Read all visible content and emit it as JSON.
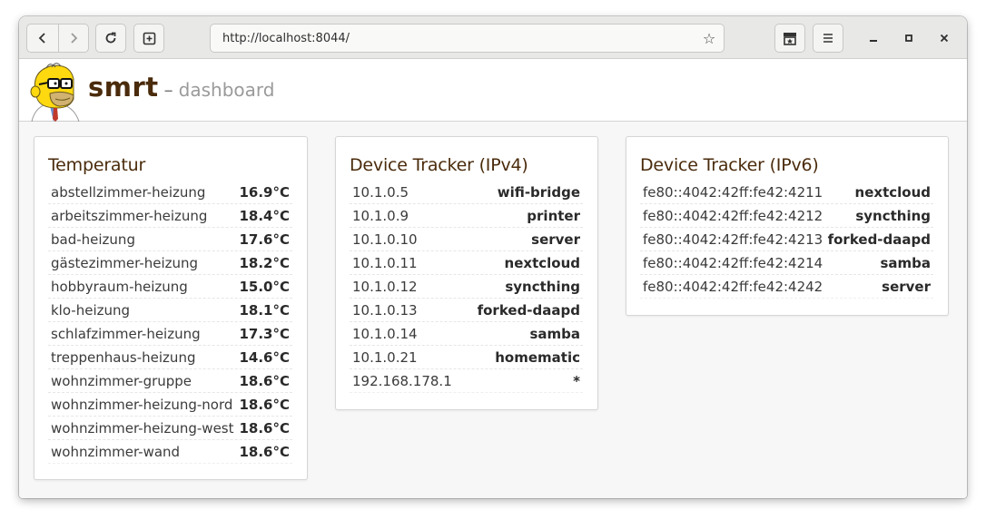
{
  "browser": {
    "url": "http://localhost:8044/",
    "icons": {
      "back": "arrow-left-icon",
      "forward": "arrow-right-icon",
      "reload": "reload-icon",
      "new_tab": "new-tab-icon",
      "bookmark": "star-icon",
      "library": "library-icon",
      "menu": "hamburger-menu-icon",
      "minimize": "minimize-icon",
      "maximize": "maximize-icon",
      "close": "close-icon"
    }
  },
  "header": {
    "app_name": "smrt",
    "separator": "–",
    "page_title": "dashboard"
  },
  "colors": {
    "brand": "#4a2b0c",
    "card_border": "#d6d6d6",
    "background": "#f7f7f7"
  },
  "cards": {
    "temperature": {
      "title": "Temperatur",
      "rows": [
        {
          "name": "abstellzimmer-heizung",
          "value": "16.9°C"
        },
        {
          "name": "arbeitszimmer-heizung",
          "value": "18.4°C"
        },
        {
          "name": "bad-heizung",
          "value": "17.6°C"
        },
        {
          "name": "gästezimmer-heizung",
          "value": "18.2°C"
        },
        {
          "name": "hobbyraum-heizung",
          "value": "15.0°C"
        },
        {
          "name": "klo-heizung",
          "value": "18.1°C"
        },
        {
          "name": "schlafzimmer-heizung",
          "value": "17.3°C"
        },
        {
          "name": "treppenhaus-heizung",
          "value": "14.6°C"
        },
        {
          "name": "wohnzimmer-gruppe",
          "value": "18.6°C"
        },
        {
          "name": "wohnzimmer-heizung-nord",
          "value": "18.6°C"
        },
        {
          "name": "wohnzimmer-heizung-west",
          "value": "18.6°C"
        },
        {
          "name": "wohnzimmer-wand",
          "value": "18.6°C"
        }
      ]
    },
    "ipv4": {
      "title": "Device Tracker (IPv4)",
      "rows": [
        {
          "address": "10.1.0.5",
          "device": "wifi-bridge"
        },
        {
          "address": "10.1.0.9",
          "device": "printer"
        },
        {
          "address": "10.1.0.10",
          "device": "server"
        },
        {
          "address": "10.1.0.11",
          "device": "nextcloud"
        },
        {
          "address": "10.1.0.12",
          "device": "syncthing"
        },
        {
          "address": "10.1.0.13",
          "device": "forked-daapd"
        },
        {
          "address": "10.1.0.14",
          "device": "samba"
        },
        {
          "address": "10.1.0.21",
          "device": "homematic"
        },
        {
          "address": "192.168.178.1",
          "device": "*"
        }
      ]
    },
    "ipv6": {
      "title": "Device Tracker (IPv6)",
      "rows": [
        {
          "address": "fe80::4042:42ff:fe42:4211",
          "device": "nextcloud"
        },
        {
          "address": "fe80::4042:42ff:fe42:4212",
          "device": "syncthing"
        },
        {
          "address": "fe80::4042:42ff:fe42:4213",
          "device": "forked-daapd"
        },
        {
          "address": "fe80::4042:42ff:fe42:4214",
          "device": "samba"
        },
        {
          "address": "fe80::4042:42ff:fe42:4242",
          "device": "server"
        }
      ]
    }
  }
}
